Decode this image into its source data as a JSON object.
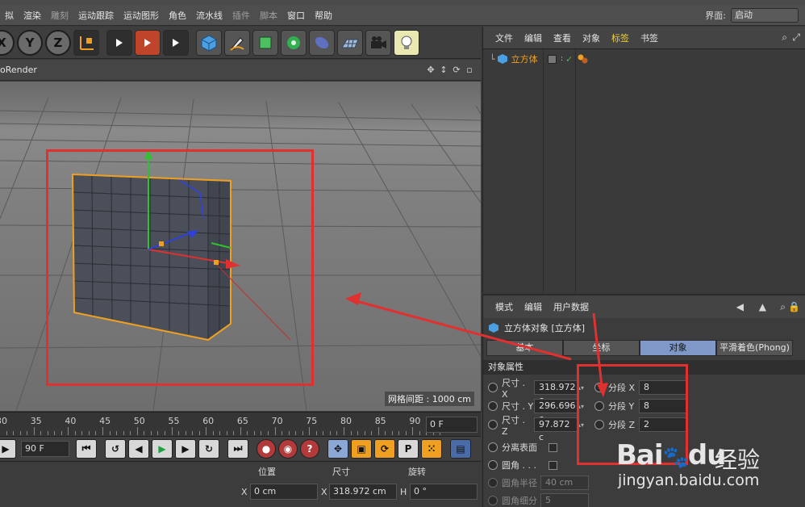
{
  "menubar": {
    "items": [
      "拟",
      "渲染",
      "雕刻",
      "运动跟踪",
      "运动图形",
      "角色",
      "流水线",
      "插件",
      "脚本",
      "窗口",
      "帮助"
    ],
    "layout_label": "界面:",
    "layout_value": "启动"
  },
  "toolbar": {
    "axis_buttons": [
      "X",
      "Y",
      "Z"
    ]
  },
  "viewport": {
    "renderer_label": "oRender",
    "grid_distance": "网格间距 : 1000 cm"
  },
  "timeline": {
    "ticks": [
      "30",
      "35",
      "40",
      "45",
      "50",
      "55",
      "60",
      "65",
      "70",
      "75",
      "80",
      "85",
      "90"
    ],
    "current_frame": "0 F"
  },
  "transport": {
    "end_frame": "90 F"
  },
  "coords": {
    "headers": {
      "position": "位置",
      "size": "尺寸",
      "rotation": "旋转"
    },
    "row_x": {
      "axis": "X",
      "position": "0 cm",
      "size_axis": "X",
      "size": "318.972 cm",
      "rot_axis": "H",
      "rotation": "0 °"
    }
  },
  "object_manager": {
    "menu": [
      "文件",
      "编辑",
      "查看",
      "对象",
      "标签",
      "书签"
    ],
    "highlight_menu": "标签",
    "object_name": "立方体"
  },
  "attributes": {
    "menu": [
      "模式",
      "编辑",
      "用户数据"
    ],
    "title": "立方体对象 [立方体]",
    "tabs": [
      "基本",
      "坐标",
      "对象",
      "平滑着色(Phong)"
    ],
    "active_tab": "对象",
    "section": "对象属性",
    "size": [
      {
        "label": "尺寸 . X",
        "value": "318.972 c"
      },
      {
        "label": "尺寸 . Y",
        "value": "296.696 c"
      },
      {
        "label": "尺寸 . Z",
        "value": "97.872 c"
      }
    ],
    "segments": [
      {
        "label": "分段 X",
        "value": "8"
      },
      {
        "label": "分段 Y",
        "value": "8"
      },
      {
        "label": "分段 Z",
        "value": "2"
      }
    ],
    "separate_surfaces": "分离表面",
    "fillet": "圆角 . . .",
    "fillet_radius": {
      "label": "圆角半径",
      "value": "40 cm"
    },
    "fillet_subdiv": {
      "label": "圆角细分",
      "value": "5"
    }
  },
  "watermark": {
    "logo": "Bai",
    "logo_suffix": "du",
    "cn": "经验",
    "url": "jingyan.baidu.com"
  },
  "colors": {
    "annotation_red": "#e03030",
    "active_tab": "#7f98c8",
    "selection_orange": "#f0a020"
  }
}
